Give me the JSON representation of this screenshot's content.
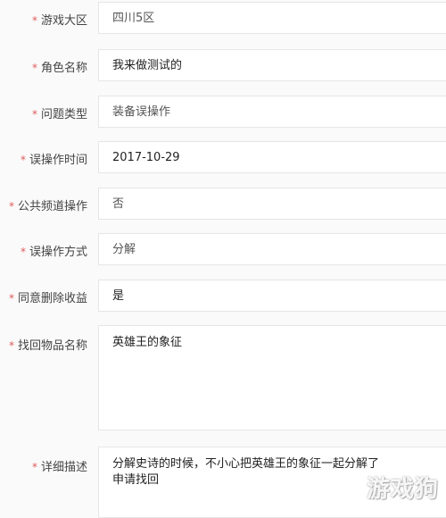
{
  "form": {
    "required_mark": "*",
    "fields": [
      {
        "label": "游戏大区",
        "value": "四川5区"
      },
      {
        "label": "角色名称",
        "value": "我来做测试的"
      },
      {
        "label": "问题类型",
        "value": "装备误操作"
      },
      {
        "label": "误操作时间",
        "value": "2017-10-29"
      },
      {
        "label": "公共频道操作",
        "value": "否"
      },
      {
        "label": "误操作方式",
        "value": "分解"
      },
      {
        "label": "同意删除收益",
        "value": "是"
      },
      {
        "label": "找回物品名称",
        "value": "英雄王的象征"
      },
      {
        "label": "详细描述",
        "value_lines": [
          "分解史诗的时候，不小心把英雄王的象征一起分解了",
          "申请找回"
        ]
      }
    ]
  },
  "watermark": "游戏狗"
}
